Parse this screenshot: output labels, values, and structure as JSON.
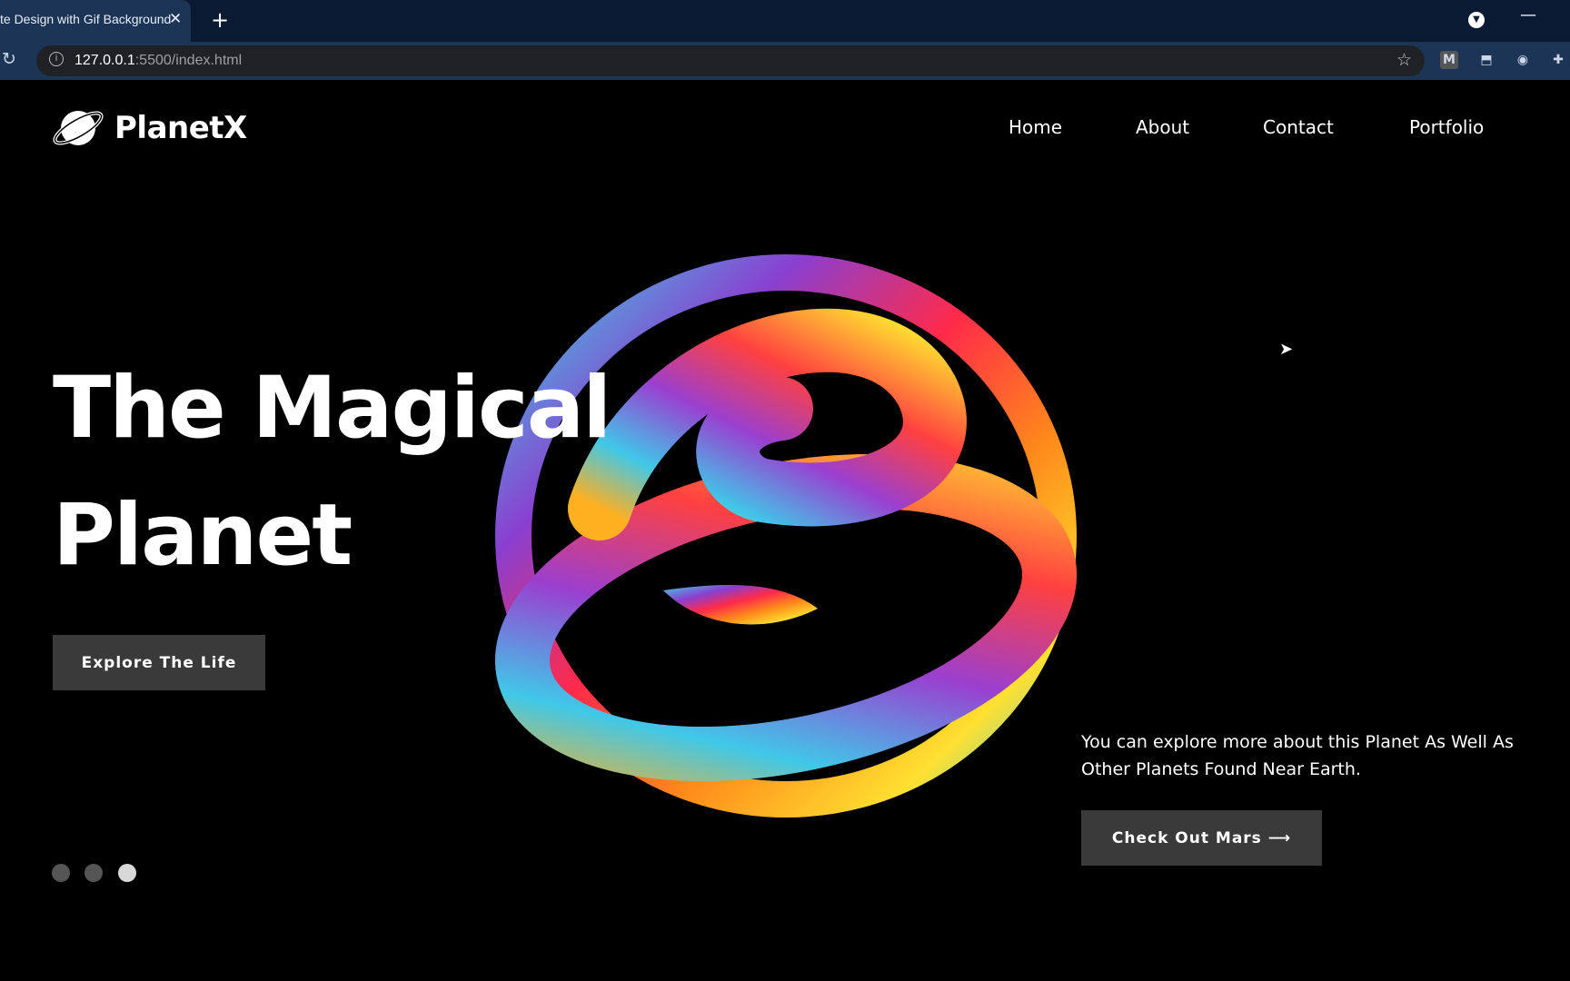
{
  "browser": {
    "tab_title": "te Design with Gif Background",
    "tab_close": "✕",
    "new_tab": "+",
    "url_host": "127.0.0.1",
    "url_path": ":5500/index.html",
    "extensions": [
      "M",
      "a",
      "camera",
      "puzzle"
    ]
  },
  "site": {
    "logo": "PlanetX",
    "nav": [
      "Home",
      "About",
      "Contact",
      "Portfolio"
    ],
    "headline": [
      "The Magical",
      "Planet"
    ],
    "primary_button": "Explore The Life",
    "description": "You can explore more about this Planet As Well As Other Planets Found Near Earth.",
    "secondary_button": "Check Out Mars ⟶",
    "slider": {
      "count": 3,
      "active": 3
    },
    "colors": {
      "background": "#000000",
      "button": "#3a3a3a",
      "text": "#ffffff"
    }
  }
}
